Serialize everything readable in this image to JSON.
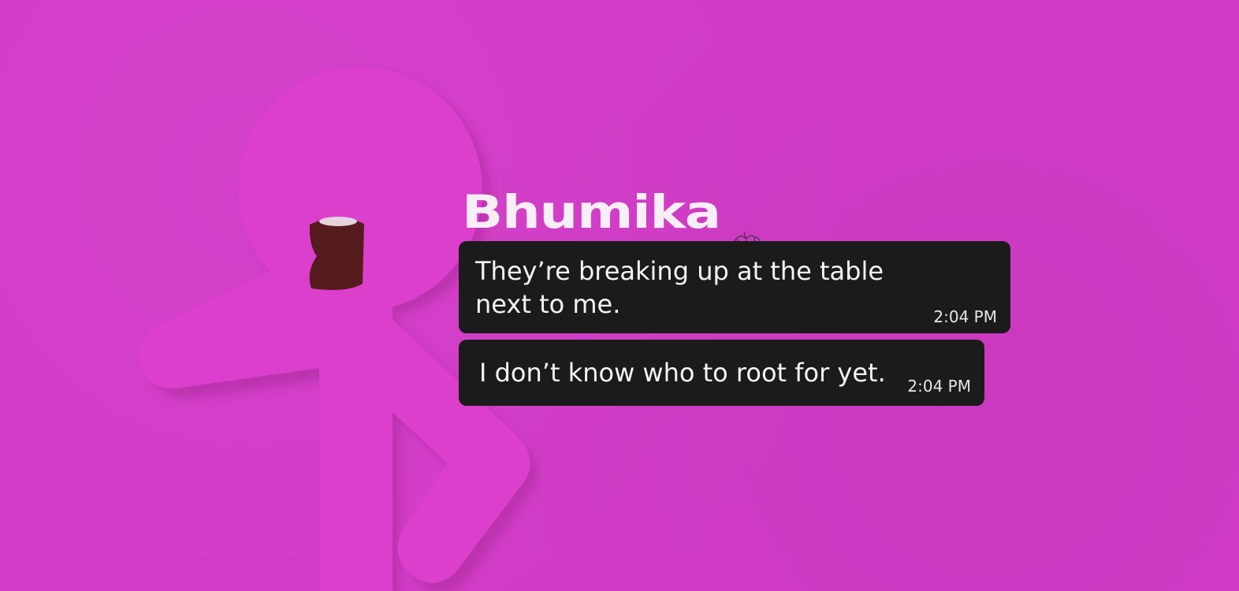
{
  "colors": {
    "background": "#d23bc7",
    "figure": "#db3fcc",
    "figure_shadow": "#a92a9b",
    "cup": "#561b1d",
    "cup_lid": "#e3d4dd",
    "bubble": "#1b1b1b",
    "name_text": "#f7eef6",
    "message_text": "#f4f4f4"
  },
  "figure": {
    "icon": "stick-figure-holding-cup-illustration"
  },
  "chat": {
    "sender": "Bhumika",
    "messages": [
      {
        "text": "They’re breaking up at the table next to me.",
        "time": "2:04 PM"
      },
      {
        "text": "I don’t know who to root for yet.",
        "time": "2:04 PM"
      }
    ]
  }
}
